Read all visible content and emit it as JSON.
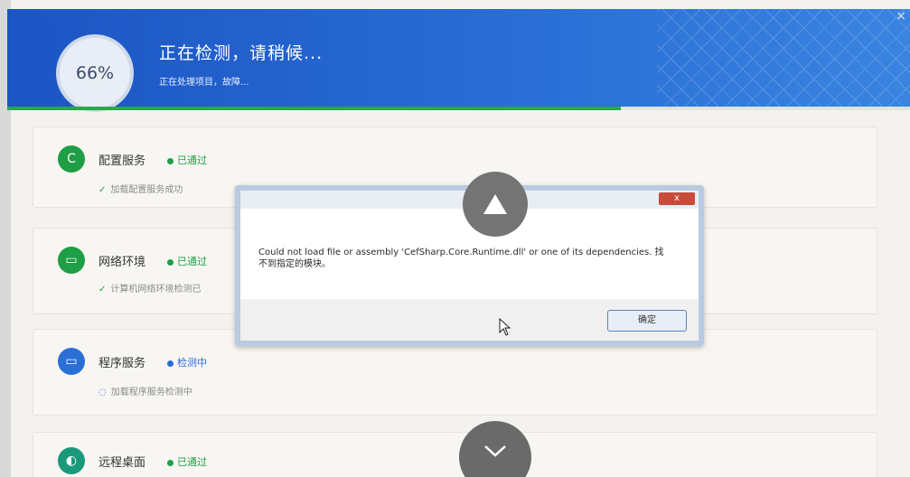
{
  "header": {
    "progress_percent": "66%",
    "progress_fraction": 0.68,
    "title": "正在检测，请稍候...",
    "subtitle": "正在处理项目，故障..."
  },
  "checks": [
    {
      "title": "配置服务",
      "status": "已通过",
      "detail": "加载配置服务成功",
      "icon": "c-icon",
      "color": "#1e9e45"
    },
    {
      "title": "网络环境",
      "status": "已通过",
      "detail": "计算机网络环境检测已",
      "icon": "monitor-icon",
      "color": "#1e9e45"
    },
    {
      "title": "程序服务",
      "status": "检测中",
      "detail": "加载程序服务检测中",
      "icon": "monitor-icon",
      "color": "#2a6fd6"
    },
    {
      "title": "远程桌面",
      "status": "已通过",
      "detail": "",
      "icon": "remote-icon",
      "color": "#1e9e45"
    }
  ],
  "dialog": {
    "close_label": "x",
    "message": "Could not load file or assembly 'CefSharp.Core.Runtime.dll' or one of its dependencies. 找不到指定的模块。",
    "ok_label": "确定"
  },
  "icons": {
    "scroll_up": "triangle-up-icon",
    "scroll_down": "chevron-down-icon"
  }
}
